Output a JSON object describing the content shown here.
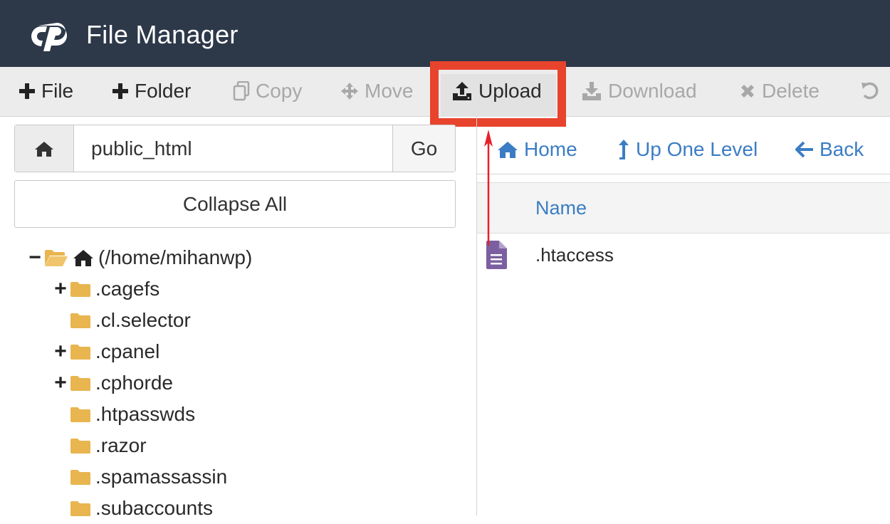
{
  "header": {
    "title": "File Manager",
    "logo_icon": "cpanel-logo-icon",
    "background": "#2d3849"
  },
  "toolbar": {
    "file_label": "File",
    "folder_label": "Folder",
    "copy_label": "Copy",
    "move_label": "Move",
    "upload_label": "Upload",
    "download_label": "Download",
    "delete_label": "Delete",
    "highlight_color": "#e8432c"
  },
  "left_panel": {
    "path_value": "public_html",
    "go_label": "Go",
    "collapse_label": "Collapse All",
    "tree": {
      "root_label": "(/home/mihanwp)",
      "items": [
        {
          "label": ".cagefs",
          "expandable": true
        },
        {
          "label": ".cl.selector",
          "expandable": false
        },
        {
          "label": ".cpanel",
          "expandable": true
        },
        {
          "label": ".cphorde",
          "expandable": true
        },
        {
          "label": ".htpasswds",
          "expandable": false
        },
        {
          "label": ".razor",
          "expandable": false
        },
        {
          "label": ".spamassassin",
          "expandable": false
        },
        {
          "label": ".subaccounts",
          "expandable": false
        }
      ]
    }
  },
  "right_panel": {
    "nav": {
      "home_label": "Home",
      "up_label": "Up One Level",
      "back_label": "Back"
    },
    "table": {
      "name_header": "Name",
      "files": [
        {
          "name": ".htaccess",
          "icon": "text-file-icon"
        }
      ]
    },
    "link_color": "#3b7dc4"
  }
}
